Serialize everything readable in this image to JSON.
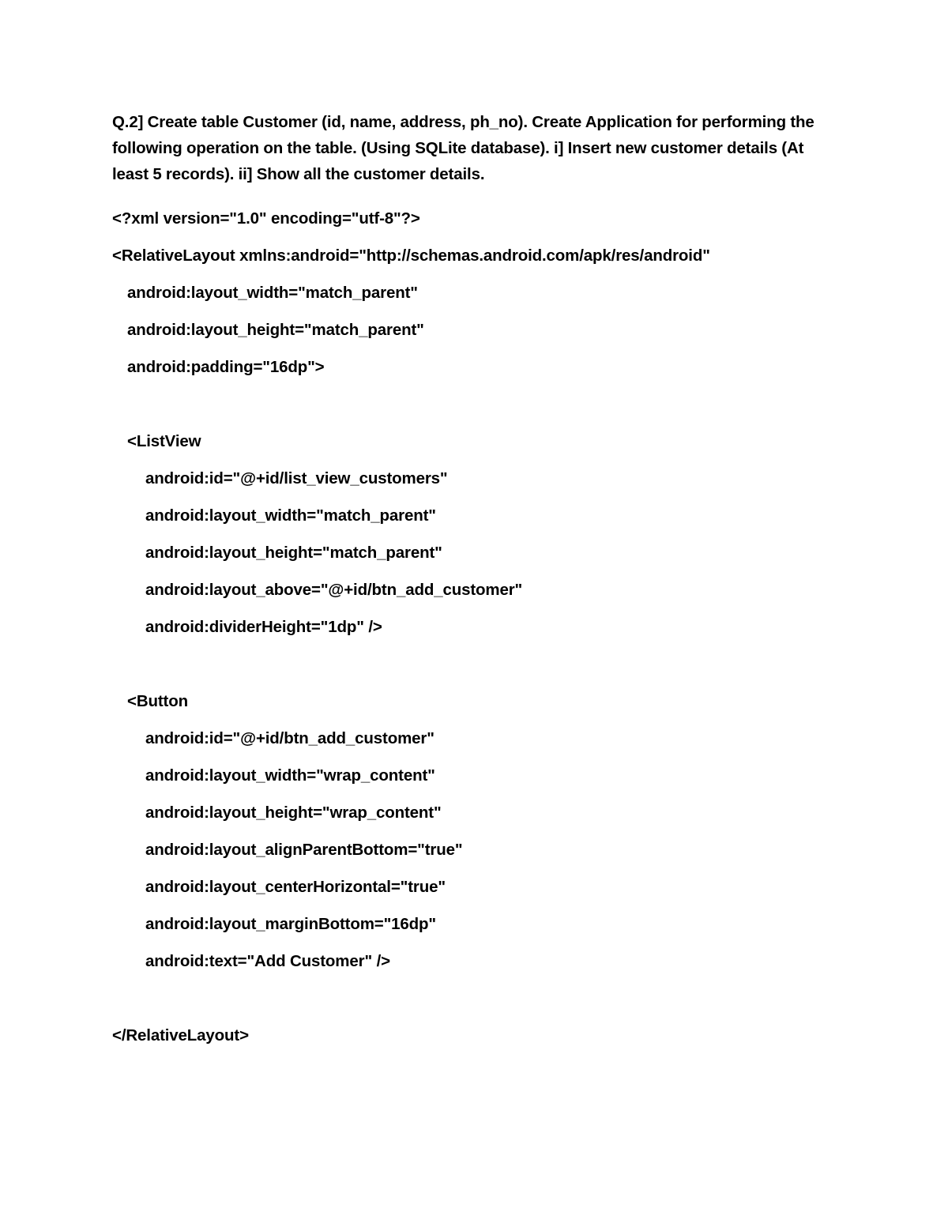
{
  "document": {
    "question": "Q.2] Create table Customer (id, name, address, ph_no). Create Application for performing the following operation on the table. (Using SQLite database). i] Insert new customer details (At least 5 records). ii] Show all the customer details.",
    "code_lines": [
      {
        "text": "<?xml version=\"1.0\" encoding=\"utf-8\"?>",
        "indent": 0
      },
      {
        "text": "<RelativeLayout xmlns:android=\"http://schemas.android.com/apk/res/android\"",
        "indent": 0
      },
      {
        "text": "android:layout_width=\"match_parent\"",
        "indent": 1
      },
      {
        "text": "android:layout_height=\"match_parent\"",
        "indent": 1
      },
      {
        "text": "android:padding=\"16dp\">",
        "indent": 1
      },
      {
        "text": "",
        "indent": 0
      },
      {
        "text": "<ListView",
        "indent": 1
      },
      {
        "text": "android:id=\"@+id/list_view_customers\"",
        "indent": 2
      },
      {
        "text": "android:layout_width=\"match_parent\"",
        "indent": 2
      },
      {
        "text": "android:layout_height=\"match_parent\"",
        "indent": 2
      },
      {
        "text": "android:layout_above=\"@+id/btn_add_customer\"",
        "indent": 2
      },
      {
        "text": "android:dividerHeight=\"1dp\" />",
        "indent": 2
      },
      {
        "text": "",
        "indent": 0
      },
      {
        "text": "<Button",
        "indent": 1
      },
      {
        "text": "android:id=\"@+id/btn_add_customer\"",
        "indent": 2
      },
      {
        "text": "android:layout_width=\"wrap_content\"",
        "indent": 2
      },
      {
        "text": "android:layout_height=\"wrap_content\"",
        "indent": 2
      },
      {
        "text": "android:layout_alignParentBottom=\"true\"",
        "indent": 2
      },
      {
        "text": "android:layout_centerHorizontal=\"true\"",
        "indent": 2
      },
      {
        "text": "android:layout_marginBottom=\"16dp\"",
        "indent": 2
      },
      {
        "text": "android:text=\"Add Customer\" />",
        "indent": 2
      },
      {
        "text": "",
        "indent": 0
      },
      {
        "text": "</RelativeLayout>",
        "indent": 0
      }
    ]
  },
  "colors": {
    "page_background": "#ffffff",
    "text": "#000000"
  }
}
